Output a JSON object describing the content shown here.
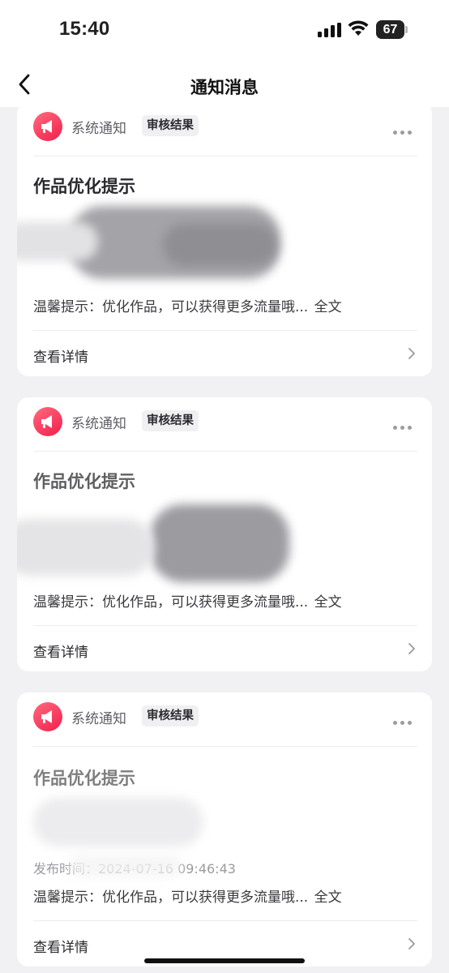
{
  "status_bar": {
    "time": "15:40",
    "battery": "67"
  },
  "nav": {
    "title": "通知消息",
    "back_icon": "chevron-left-icon"
  },
  "notifications": [
    {
      "sender": "系统通知",
      "tag": "审核结果",
      "title": "作品优化提示",
      "meta": "",
      "tip": "温馨提示：优化作品，可以获得更多流量哦...",
      "full_text": "全文",
      "detail": "查看详情"
    },
    {
      "sender": "系统通知",
      "tag": "审核结果",
      "title": "作品优化提示",
      "meta": "",
      "tip": "温馨提示：优化作品，可以获得更多流量哦...",
      "full_text": "全文",
      "detail": "查看详情"
    },
    {
      "sender": "系统通知",
      "tag": "审核结果",
      "title": "作品优化提示",
      "meta": "发布时间：2024-07-16 09:46:43",
      "tip": "温馨提示：优化作品，可以获得更多流量哦...",
      "full_text": "全文",
      "detail": "查看详情"
    }
  ]
}
